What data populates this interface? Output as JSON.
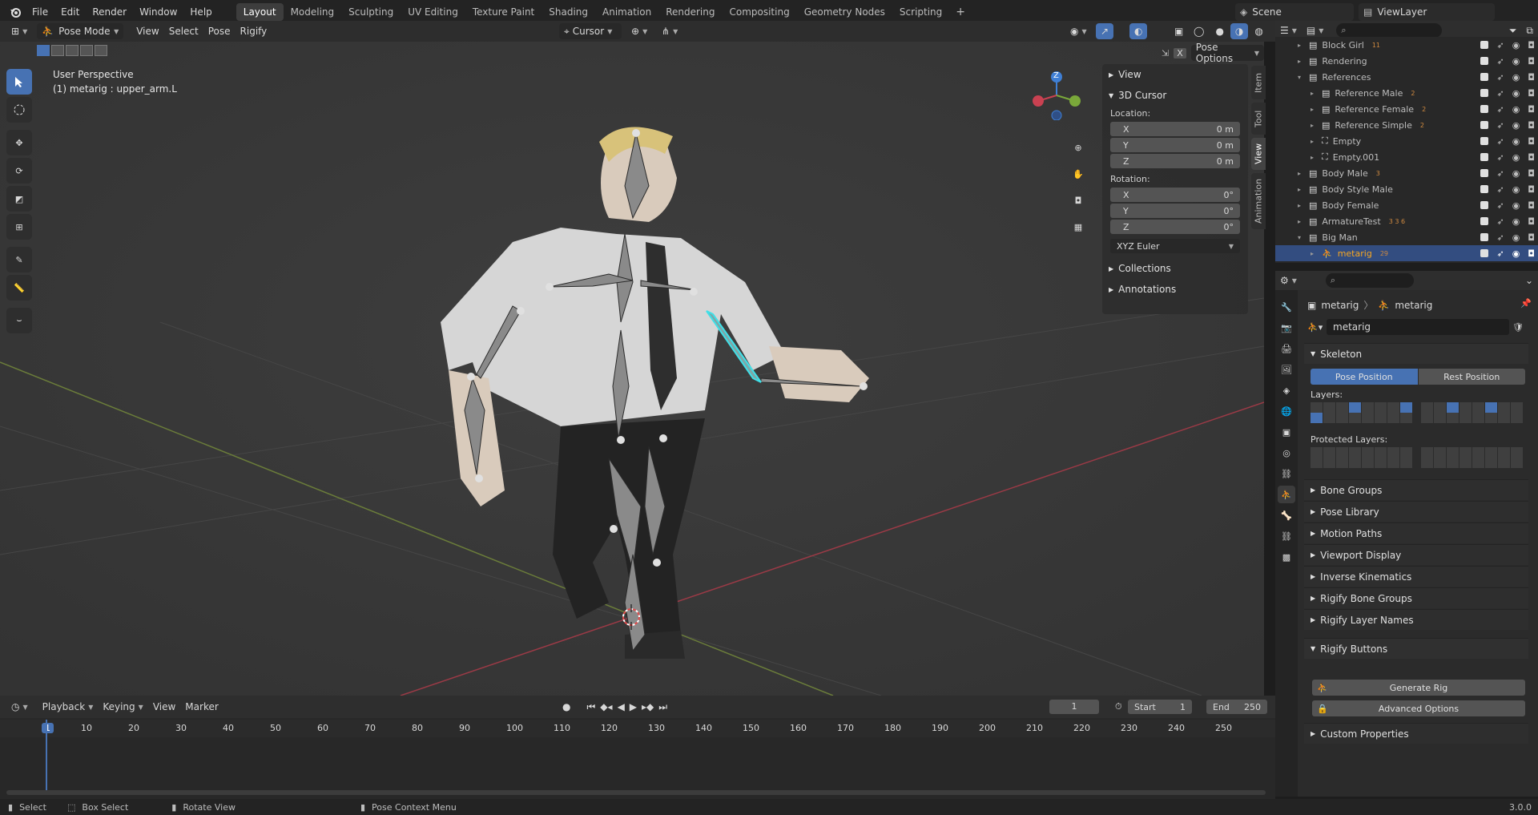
{
  "topbar": {
    "menus": [
      "File",
      "Edit",
      "Render",
      "Window",
      "Help"
    ],
    "workspaces": [
      "Layout",
      "Modeling",
      "Sculpting",
      "UV Editing",
      "Texture Paint",
      "Shading",
      "Animation",
      "Rendering",
      "Compositing",
      "Geometry Nodes",
      "Scripting"
    ],
    "active_workspace": "Layout",
    "scene": "Scene",
    "view_layer": "ViewLayer"
  },
  "viewport_header": {
    "mode": "Pose Mode",
    "menus": [
      "View",
      "Select",
      "Pose",
      "Rigify"
    ],
    "pivot": "Cursor",
    "pose_options": "Pose Options"
  },
  "viewport": {
    "perspective": "User Perspective",
    "active": "(1) metarig : upper_arm.L",
    "gizmo_axis_z": "Z"
  },
  "npanel": {
    "view_label": "View",
    "cursor_label": "3D Cursor",
    "location_label": "Location:",
    "location": [
      {
        "axis": "X",
        "value": "0 m"
      },
      {
        "axis": "Y",
        "value": "0 m"
      },
      {
        "axis": "Z",
        "value": "0 m"
      }
    ],
    "rotation_label": "Rotation:",
    "rotation": [
      {
        "axis": "X",
        "value": "0°"
      },
      {
        "axis": "Y",
        "value": "0°"
      },
      {
        "axis": "Z",
        "value": "0°"
      }
    ],
    "rotation_mode": "XYZ Euler",
    "collections_label": "Collections",
    "annotations_label": "Annotations",
    "tabs": [
      "Item",
      "Tool",
      "View",
      "Animation"
    ]
  },
  "outliner": {
    "rows": [
      {
        "name": "Block Girl",
        "indent": 1,
        "expand": "▸",
        "badge": "11"
      },
      {
        "name": "Rendering",
        "indent": 1,
        "expand": "▸",
        "badge": ""
      },
      {
        "name": "References",
        "indent": 1,
        "expand": "▾",
        "badge": ""
      },
      {
        "name": "Reference Male",
        "indent": 2,
        "expand": "▸",
        "badge": "2"
      },
      {
        "name": "Reference Female",
        "indent": 2,
        "expand": "▸",
        "badge": "2"
      },
      {
        "name": "Reference Simple",
        "indent": 2,
        "expand": "▸",
        "badge": "2"
      },
      {
        "name": "Empty",
        "indent": 2,
        "expand": "▸",
        "badge": ""
      },
      {
        "name": "Empty.001",
        "indent": 2,
        "expand": "▸",
        "badge": ""
      },
      {
        "name": "Body Male",
        "indent": 1,
        "expand": "▸",
        "badge": "3"
      },
      {
        "name": "Body Style Male",
        "indent": 1,
        "expand": "▸",
        "badge": ""
      },
      {
        "name": "Body Female",
        "indent": 1,
        "expand": "▸",
        "badge": ""
      },
      {
        "name": "ArmatureTest",
        "indent": 1,
        "expand": "▸",
        "badge": "3 3 6"
      },
      {
        "name": "Big Man",
        "indent": 1,
        "expand": "▾",
        "badge": ""
      },
      {
        "name": "metarig",
        "indent": 2,
        "expand": "▸",
        "badge": "29",
        "selected": true
      }
    ]
  },
  "properties": {
    "breadcrumb_object": "metarig",
    "breadcrumb_data": "metarig",
    "datablock_name": "metarig",
    "skeleton_label": "Skeleton",
    "pose_position": "Pose Position",
    "rest_position": "Rest Position",
    "layers_label": "Layers:",
    "protected_layers_label": "Protected Layers:",
    "sections": [
      "Bone Groups",
      "Pose Library",
      "Motion Paths",
      "Viewport Display",
      "Inverse Kinematics",
      "Rigify Bone Groups",
      "Rigify Layer Names"
    ],
    "rigify_buttons_label": "Rigify Buttons",
    "generate_rig": "Generate Rig",
    "advanced_options": "Advanced Options",
    "custom_properties": "Custom Properties"
  },
  "timeline": {
    "menus": [
      "Playback",
      "Keying",
      "View",
      "Marker"
    ],
    "current_frame": "1",
    "start_label": "Start",
    "start": "1",
    "end_label": "End",
    "end": "250",
    "ticks": [
      "1",
      "10",
      "20",
      "30",
      "40",
      "50",
      "60",
      "70",
      "80",
      "90",
      "100",
      "110",
      "120",
      "130",
      "140",
      "150",
      "160",
      "170",
      "180",
      "190",
      "200",
      "210",
      "220",
      "230",
      "240",
      "250"
    ]
  },
  "statusbar": {
    "select": "Select",
    "box_select": "Box Select",
    "rotate_view": "Rotate View",
    "context_menu": "Pose Context Menu",
    "version": "3.0.0"
  },
  "colors": {
    "accent": "#4772b3",
    "selected_row": "#334d80",
    "x_axis": "#c94151",
    "y_axis": "#7aa83a",
    "z_axis": "#3f7fd5"
  }
}
